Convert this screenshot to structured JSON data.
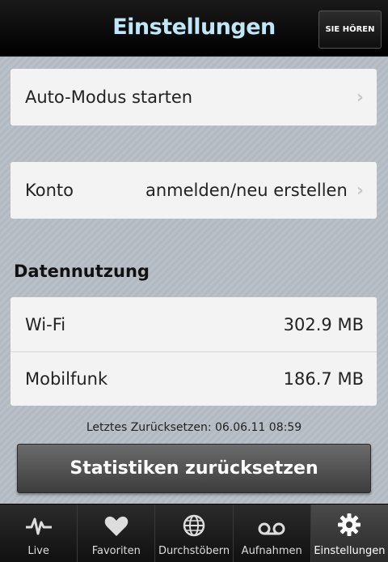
{
  "header": {
    "title": "Einstellungen",
    "listen_button": "SIE HÖREN"
  },
  "auto_mode": {
    "label": "Auto-Modus starten"
  },
  "account": {
    "label": "Konto",
    "value": "anmelden/neu erstellen"
  },
  "data_usage": {
    "heading": "Datennutzung",
    "rows": [
      {
        "label": "Wi-Fi",
        "value": "302.9 MB"
      },
      {
        "label": "Mobilfunk",
        "value": "186.7 MB"
      }
    ],
    "last_reset": "Letztes Zurücksetzen: 06.06.11 08:59",
    "reset_button": "Statistiken zurücksetzen"
  },
  "tabs": [
    {
      "label": "Live",
      "icon": "pulse-icon"
    },
    {
      "label": "Favoriten",
      "icon": "heart-icon"
    },
    {
      "label": "Durchstöbern",
      "icon": "globe-icon"
    },
    {
      "label": "Aufnahmen",
      "icon": "voicemail-icon"
    },
    {
      "label": "Einstellungen",
      "icon": "gear-icon",
      "active": true
    }
  ]
}
